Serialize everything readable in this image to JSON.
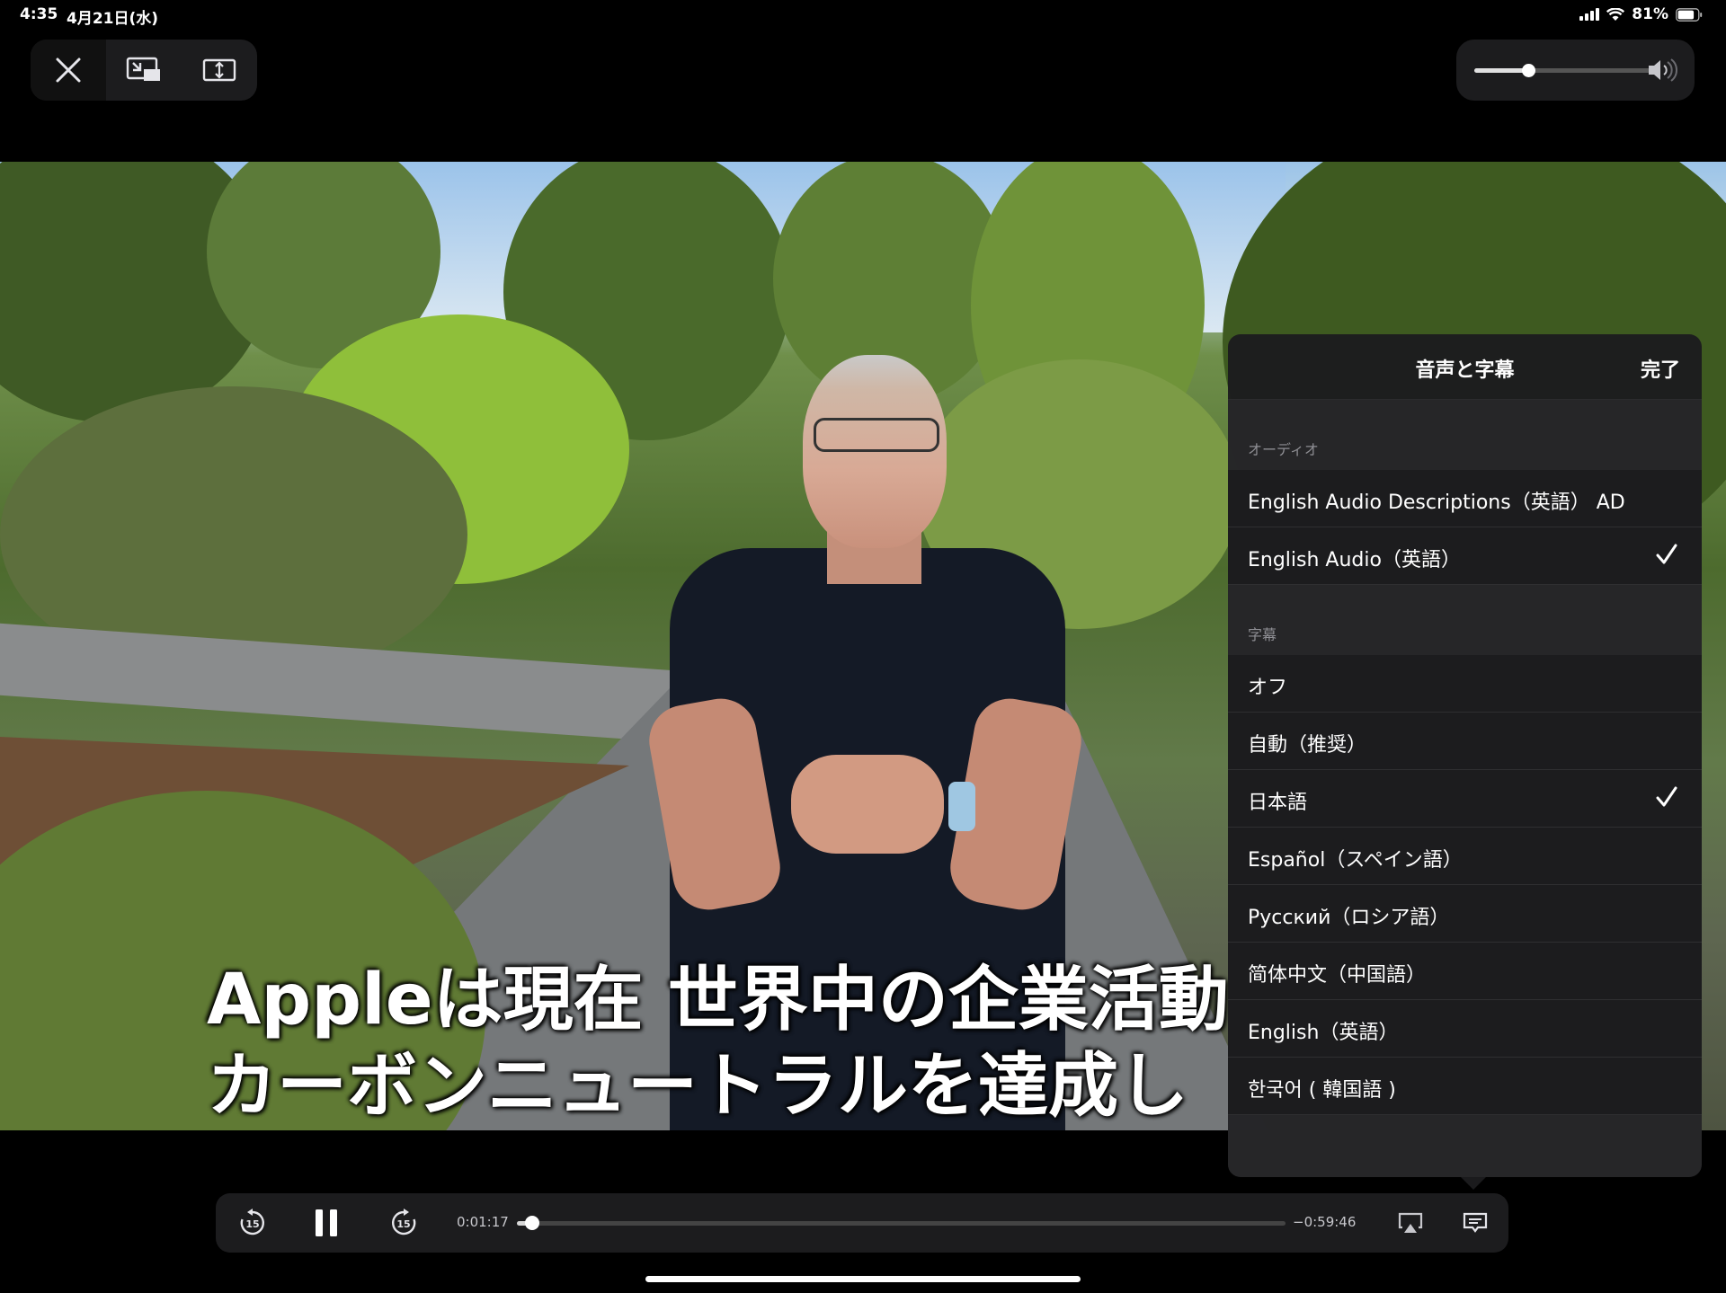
{
  "status": {
    "time": "4:35",
    "date": "4月21日(水)",
    "battery": "81%"
  },
  "volume": {
    "level": 0.3
  },
  "subtitles_overlay": {
    "line1": "Appleは現在 世界中の企業活動",
    "line2": "カーボンニュートラルを達成し"
  },
  "panel": {
    "title": "音声と字幕",
    "done": "完了",
    "audio": {
      "heading": "オーディオ",
      "items": [
        {
          "label": "English Audio Descriptions（英語） AD",
          "selected": false
        },
        {
          "label": "English Audio（英語）",
          "selected": true
        }
      ]
    },
    "subtitles": {
      "heading": "字幕",
      "items": [
        {
          "label": "オフ",
          "selected": false
        },
        {
          "label": "自動（推奨）",
          "selected": false
        },
        {
          "label": "日本語",
          "selected": true
        },
        {
          "label": "Español（スペイン語）",
          "selected": false
        },
        {
          "label": "Русский（ロシア語）",
          "selected": false
        },
        {
          "label": "简体中文（中国語）",
          "selected": false
        },
        {
          "label": "English（英語）",
          "selected": false
        },
        {
          "label": "한국어 ( 韓国語 )",
          "selected": false
        }
      ]
    }
  },
  "playback": {
    "elapsed": "0:01:17",
    "remaining": "−0:59:46",
    "progress": 0.02,
    "skip_back_seconds": "15",
    "skip_forward_seconds": "15"
  },
  "icons": {
    "close": "close-icon",
    "pip": "picture-in-picture-icon",
    "fit": "aspect-fit-icon",
    "speaker": "speaker-icon",
    "skip_back": "skip-back-15-icon",
    "pause": "pause-icon",
    "skip_forward": "skip-forward-15-icon",
    "airplay": "airplay-icon",
    "subtitles": "subtitles-icon"
  }
}
